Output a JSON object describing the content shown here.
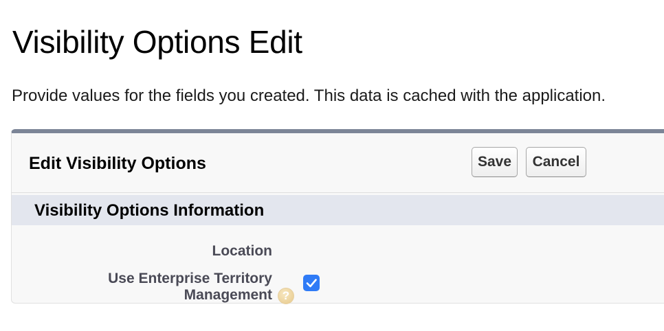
{
  "page": {
    "title": "Visibility Options Edit",
    "description": "Provide values for the fields you created. This data is cached with the application."
  },
  "panel": {
    "title": "Edit Visibility Options",
    "save_label": "Save",
    "cancel_label": "Cancel"
  },
  "section": {
    "title": "Visibility Options Information",
    "fields": [
      {
        "label": "Location",
        "value": ""
      },
      {
        "label_line1": "Use Enterprise Territory",
        "label_line2": "Management",
        "checked": true,
        "help_icon": "help-icon"
      }
    ]
  },
  "colors": {
    "panel_top_border": "#7c8597",
    "section_bar": "#e3e6ee",
    "checkbox": "#2f7bf6",
    "help_icon": "#e7c98a"
  }
}
